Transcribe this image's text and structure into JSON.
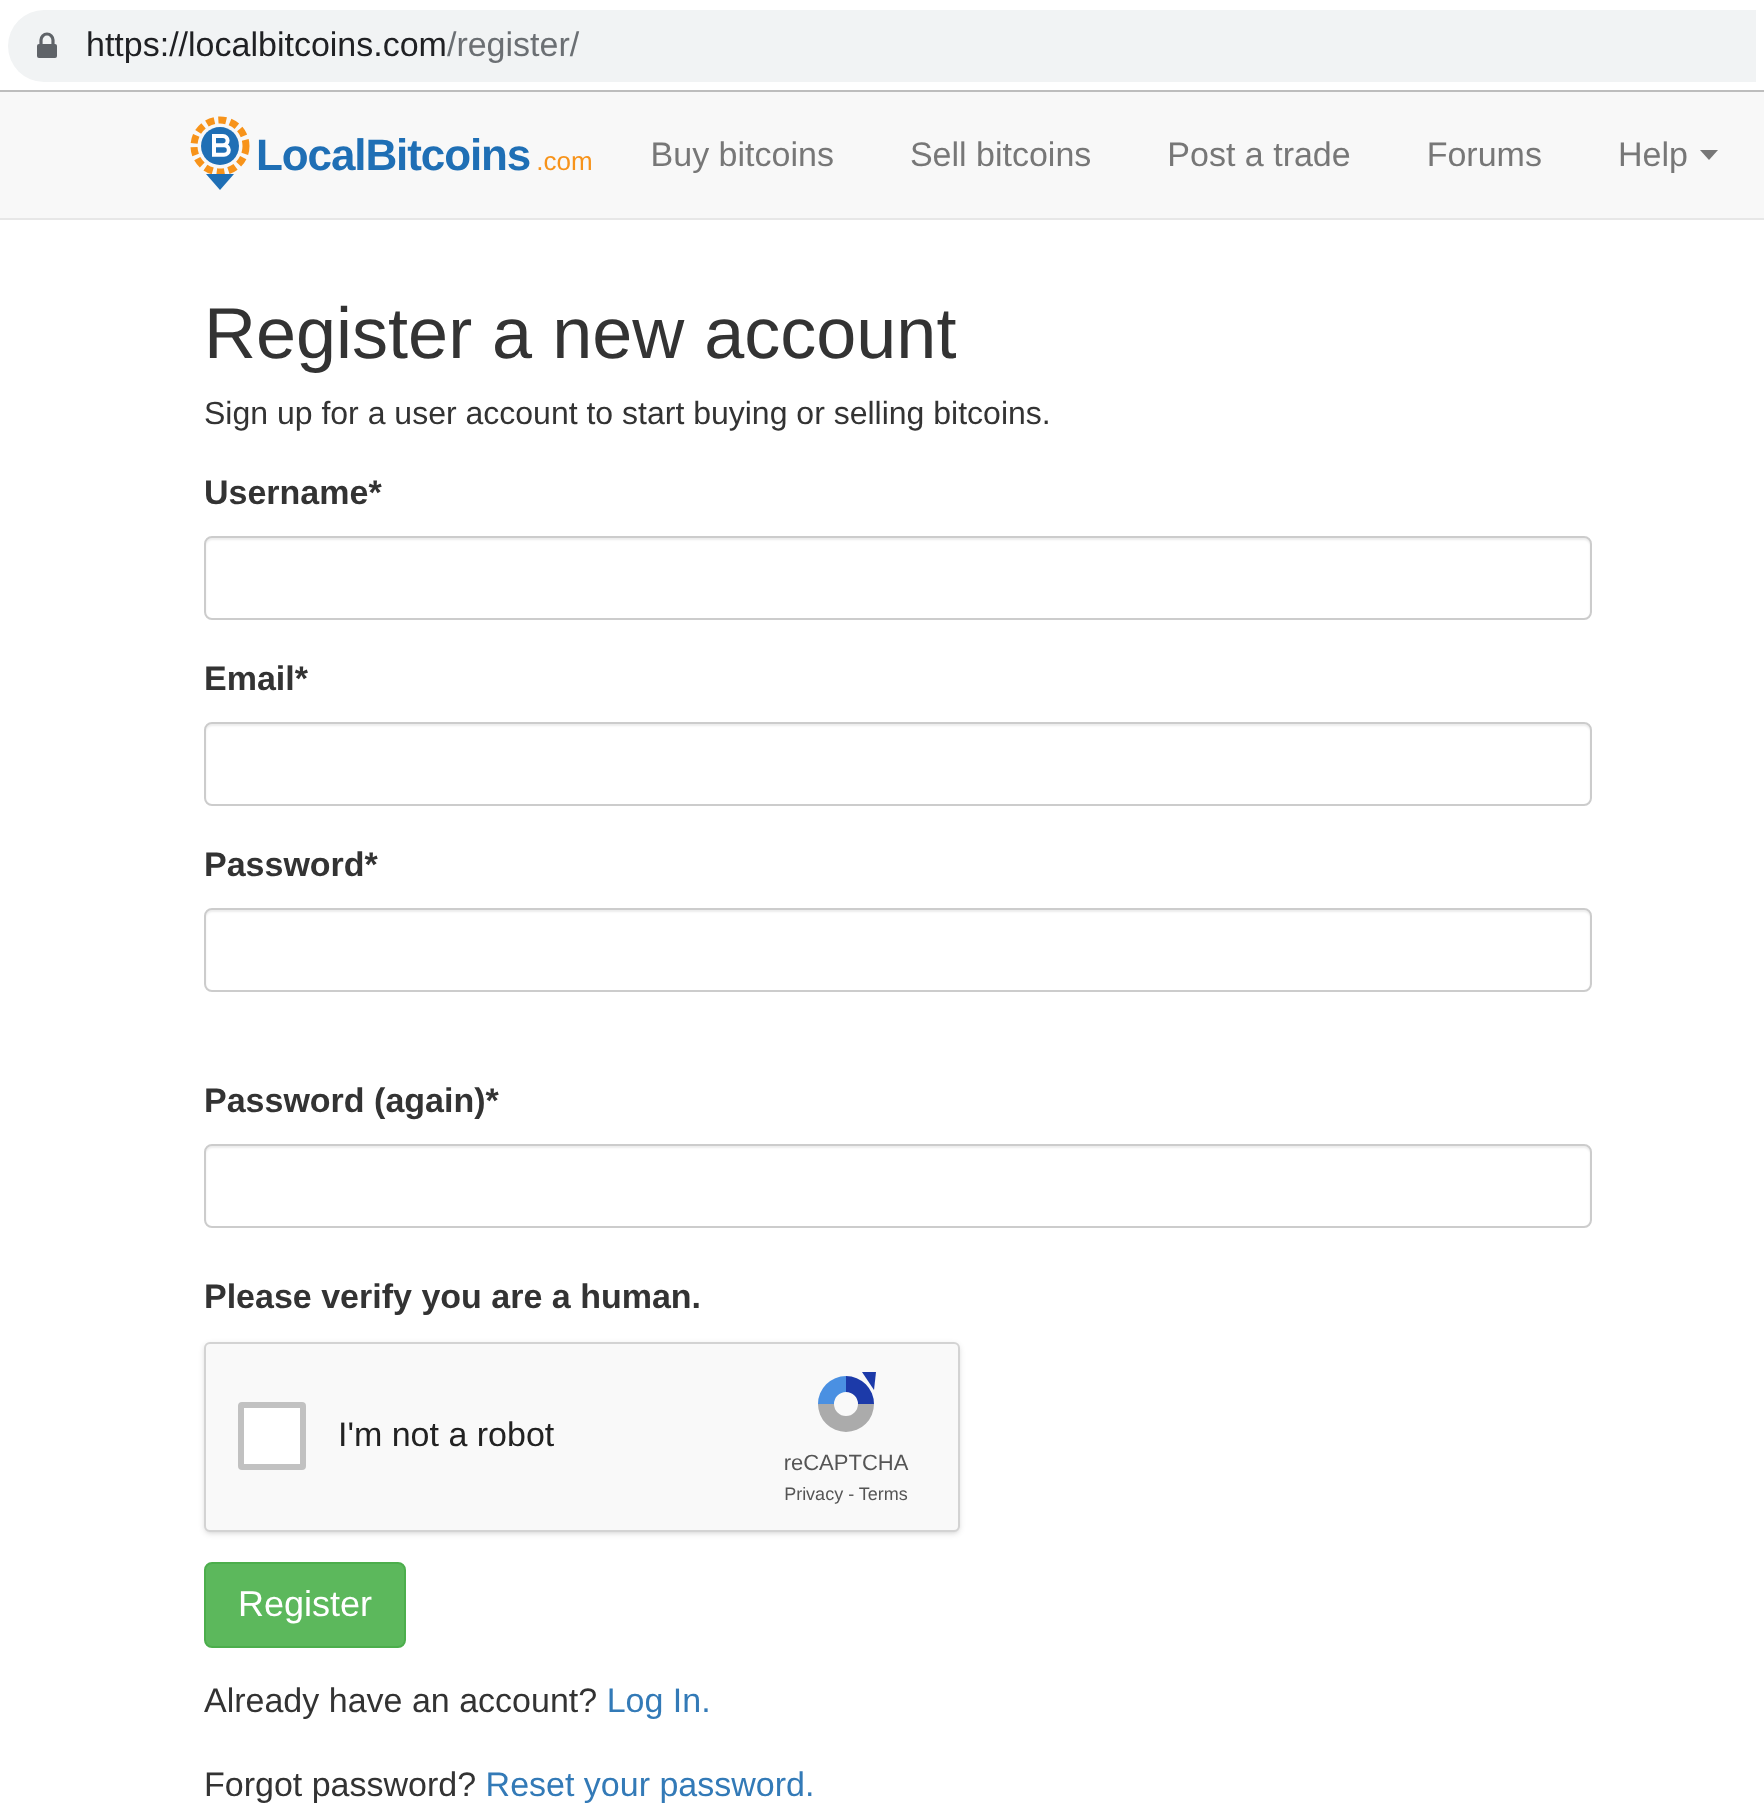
{
  "address_bar": {
    "host": "https://localbitcoins.com",
    "path": "/register/"
  },
  "navbar": {
    "logo": {
      "name": "LocalBitcoins",
      "suffix": ".com"
    },
    "items": [
      {
        "label": "Buy bitcoins",
        "dropdown": false
      },
      {
        "label": "Sell bitcoins",
        "dropdown": false
      },
      {
        "label": "Post a trade",
        "dropdown": false
      },
      {
        "label": "Forums",
        "dropdown": false
      },
      {
        "label": "Help",
        "dropdown": true
      }
    ]
  },
  "form": {
    "title": "Register a new account",
    "subtitle": "Sign up for a user account to start buying or selling bitcoins.",
    "fields": [
      {
        "label": "Username*"
      },
      {
        "label": "Email*"
      },
      {
        "label": "Password*"
      },
      {
        "label": "Password (again)*"
      }
    ],
    "captcha_heading": "Please verify you are a human.",
    "captcha": {
      "label": "I'm not a robot",
      "checked": false,
      "brand": "reCAPTCHA",
      "privacy": "Privacy",
      "separator": " - ",
      "terms": "Terms"
    },
    "submit": "Register",
    "footer_lines": [
      {
        "text": "Already have an account?",
        "link": "Log In."
      },
      {
        "text": "Forgot password?",
        "link": "Reset your password."
      }
    ]
  }
}
